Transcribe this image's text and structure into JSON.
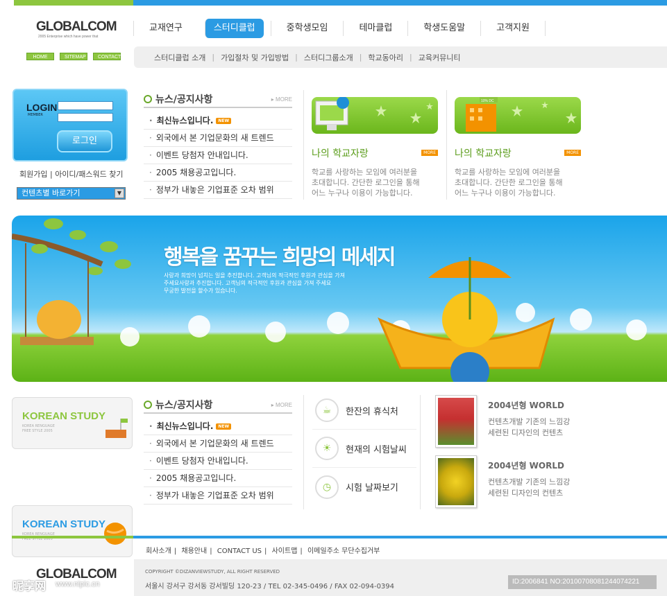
{
  "brand": {
    "logo": "GLOBALCOM",
    "tagline": "2005 Enterprise which have power that"
  },
  "mini_nav": [
    "HOME",
    "SITEMAP",
    "CONTACT"
  ],
  "main_nav": [
    "교재연구",
    "스터디클럽",
    "중학생모임",
    "테마클럽",
    "학생도움말",
    "고객지원"
  ],
  "main_nav_active": "스터디클럽",
  "sub_nav": [
    "스터디클럽 소개",
    "가입절차 및 가입방법",
    "스터디그룹소개",
    "학교동아리",
    "교육커뮤니티"
  ],
  "login": {
    "title": "LOGIN",
    "subtitle": "MEMBER",
    "button": "로그인",
    "links": [
      "회원가입",
      "아이디/패스워드 찾기"
    ],
    "select": "컨텐츠별 바로가기"
  },
  "news_top": {
    "title": "뉴스/공지사항",
    "more": "MORE",
    "new_badge": "NEW",
    "items": [
      "최신뉴스입니다.",
      "외국에서 본 기업문화의 새 트렌드",
      "이벤트 당첨자 안내입니다.",
      "2005 채용공고입니다.",
      "정부가 내놓은 기업표준 오차 범위"
    ]
  },
  "cards": [
    {
      "title": "나의 학교자랑",
      "more": "MORE",
      "desc": [
        "학교를 사랑하는 모임에 여러분을",
        "초대합니다. 간단한 로그인을 통해",
        "어느 누구나 이용이 가능합니다."
      ]
    },
    {
      "title": "나의 학교자랑",
      "more": "MORE",
      "badge": "10% DC",
      "desc": [
        "학교를 사랑하는 모임에 여러분을",
        "초대합니다. 간단한 로그인을 통해",
        "어느 누구나 이용이 가능합니다."
      ]
    }
  ],
  "banner": {
    "title": "행복을 꿈꾸는 희망의 메세지",
    "text": [
      "사랑과 희망이 넘치는 일을 추진합니다. 고객님의 적극적인 후원과 관심을 가져",
      "주세요사랑과 추진합니다.  고객님의 적극적인 후원과 관심을 가져 주세요",
      "무궁한 발전을 할수가 있습니다."
    ]
  },
  "korean_study": [
    {
      "title": "KOREAN STUDY",
      "sub1": "KOREA RENGUAGE",
      "sub2": "FREE STYLE 2005",
      "color": "#8dc63f"
    },
    {
      "title": "KOREAN STUDY",
      "sub1": "KOREA RENGUAGE",
      "sub2": "FREE STYLE 2005",
      "color": "#2b9be3"
    }
  ],
  "news_bottom": {
    "title": "뉴스/공지사항",
    "more": "MORE",
    "new_badge": "NEW",
    "items": [
      "최신뉴스입니다.",
      "외국에서 본 기업문화의 새 트렌드",
      "이벤트 당첨자 안내입니다.",
      "2005 채용공고입니다.",
      "정부가 내놓은 기업표준 오차 범위"
    ]
  },
  "quick_links": [
    {
      "label": "한잔의 휴식처",
      "icon": "cup-icon"
    },
    {
      "label": "현재의 시험날씨",
      "icon": "weather-icon"
    },
    {
      "label": "시험 날짜보기",
      "icon": "clock-icon"
    }
  ],
  "world": [
    {
      "title": "2004년형 WORLD",
      "desc": [
        "컨텐츠개발 기존의 느낌강",
        "세련된 디자인의 컨텐츠"
      ]
    },
    {
      "title": "2004년형 WORLD",
      "desc": [
        "컨텐츠개발 기존의 느낌강",
        "세련된 디자인의 컨텐츠"
      ]
    }
  ],
  "footer": {
    "links": [
      "회사소개",
      "채용안내",
      "CONTACT US",
      "사이트맵",
      "이메일주소 무단수집거부"
    ],
    "copyright": "COPYRIGHT ©DIZANVIEWSTUDY, ALL RIGHT RESERVED",
    "address": "서울시 강서구 강서동 강서빌딩 120-23 / TEL 02-345-0496 / FAX 02-094-0394",
    "logo": "GLOBALCOM",
    "watermark": "昵享网",
    "watermark_url": "www.nipic.cn",
    "image_id": "ID:2006841 NO:20100708081244074221"
  }
}
